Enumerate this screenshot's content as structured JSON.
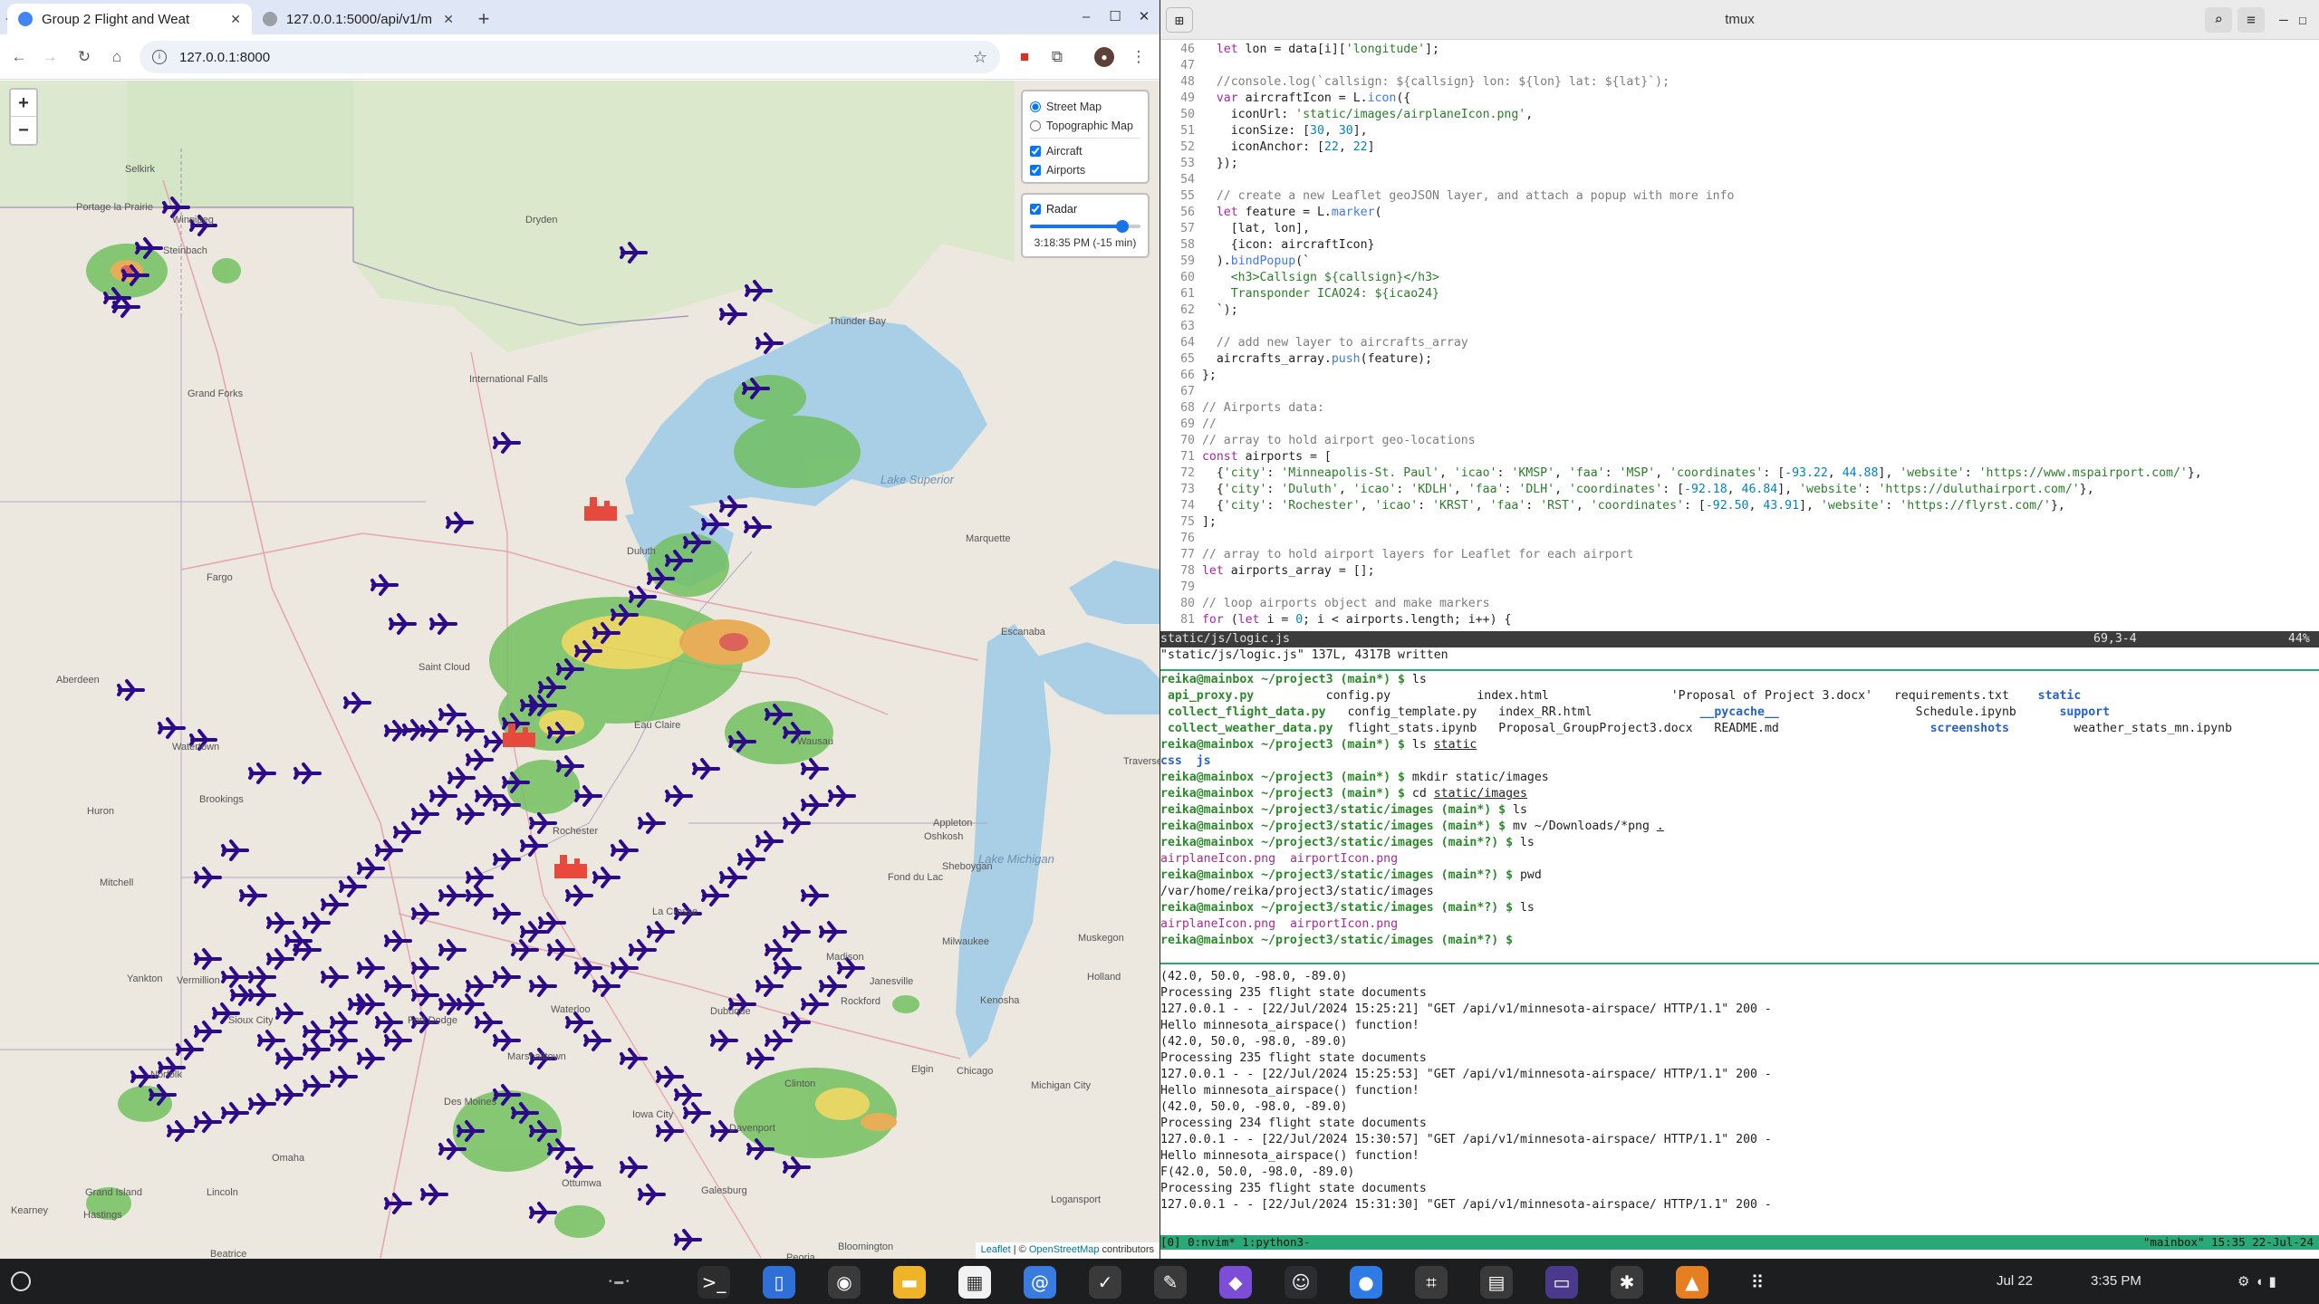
{
  "browser": {
    "tabs": [
      {
        "title": "Group 2 Flight and Weat"
      },
      {
        "title": "127.0.0.1:5000/api/v1/m"
      }
    ],
    "url": "127.0.0.1:8000"
  },
  "map": {
    "base_layers": [
      "Street Map",
      "Topographic Map"
    ],
    "selected_base": "Street Map",
    "overlays": [
      {
        "label": "Aircraft",
        "checked": true
      },
      {
        "label": "Airports",
        "checked": true
      }
    ],
    "radar": {
      "label": "Radar",
      "checked": true,
      "time": "3:18:35 PM (-15 min)",
      "slider_fraction": 0.82
    },
    "zoom_in": "+",
    "zoom_out": "−",
    "attribution": {
      "leaflet": "Leaflet",
      "sep": " | © ",
      "osm": "OpenStreetMap",
      "tail": " contributors"
    },
    "places": [
      {
        "name": "Selkirk",
        "cls": ""
      },
      {
        "name": "Portage la Prairie",
        "cls": ""
      },
      {
        "name": "Winnipeg",
        "cls": ""
      },
      {
        "name": "Steinbach",
        "cls": ""
      },
      {
        "name": "Dryden",
        "cls": ""
      },
      {
        "name": "Thunder Bay",
        "cls": ""
      },
      {
        "name": "International Falls",
        "cls": ""
      },
      {
        "name": "Grand Forks",
        "cls": ""
      },
      {
        "name": "Lake Superior",
        "cls": "lake"
      },
      {
        "name": "Fargo",
        "cls": ""
      },
      {
        "name": "Duluth",
        "cls": ""
      },
      {
        "name": "Marquette",
        "cls": ""
      },
      {
        "name": "Aberdeen",
        "cls": ""
      },
      {
        "name": "Saint Cloud",
        "cls": ""
      },
      {
        "name": "Escanaba",
        "cls": ""
      },
      {
        "name": "Watertown",
        "cls": ""
      },
      {
        "name": "Brookings",
        "cls": ""
      },
      {
        "name": "Eau Claire",
        "cls": ""
      },
      {
        "name": "Wausau",
        "cls": ""
      },
      {
        "name": "Traverse City",
        "cls": ""
      },
      {
        "name": "Huron",
        "cls": ""
      },
      {
        "name": "Rochester",
        "cls": ""
      },
      {
        "name": "Appleton",
        "cls": ""
      },
      {
        "name": "Oshkosh",
        "cls": ""
      },
      {
        "name": "Lake Michigan",
        "cls": "lake"
      },
      {
        "name": "Mitchell",
        "cls": ""
      },
      {
        "name": "La Crosse",
        "cls": ""
      },
      {
        "name": "Sheboygan",
        "cls": ""
      },
      {
        "name": "Fond du Lac",
        "cls": ""
      },
      {
        "name": "Milwaukee",
        "cls": ""
      },
      {
        "name": "Muskegon",
        "cls": ""
      },
      {
        "name": "Madison",
        "cls": ""
      },
      {
        "name": "Janesville",
        "cls": ""
      },
      {
        "name": "Holland",
        "cls": ""
      },
      {
        "name": "Yankton",
        "cls": ""
      },
      {
        "name": "Vermillion",
        "cls": ""
      },
      {
        "name": "Sioux City",
        "cls": ""
      },
      {
        "name": "Fort Dodge",
        "cls": ""
      },
      {
        "name": "Waterloo",
        "cls": ""
      },
      {
        "name": "Dubuque",
        "cls": ""
      },
      {
        "name": "Rockford",
        "cls": ""
      },
      {
        "name": "Kenosha",
        "cls": ""
      },
      {
        "name": "Norfolk",
        "cls": ""
      },
      {
        "name": "Marshalltown",
        "cls": ""
      },
      {
        "name": "Elgin",
        "cls": ""
      },
      {
        "name": "Chicago",
        "cls": ""
      },
      {
        "name": "Michigan City",
        "cls": ""
      },
      {
        "name": "Des Moines",
        "cls": ""
      },
      {
        "name": "Iowa City",
        "cls": ""
      },
      {
        "name": "Davenport",
        "cls": ""
      },
      {
        "name": "Clinton",
        "cls": ""
      },
      {
        "name": "Omaha",
        "cls": ""
      },
      {
        "name": "Ottumwa",
        "cls": ""
      },
      {
        "name": "Galesburg",
        "cls": ""
      },
      {
        "name": "Logansport",
        "cls": ""
      },
      {
        "name": "Lincoln",
        "cls": ""
      },
      {
        "name": "Grand Island",
        "cls": ""
      },
      {
        "name": "Hastings",
        "cls": ""
      },
      {
        "name": "Kearney",
        "cls": ""
      },
      {
        "name": "Beatrice",
        "cls": ""
      },
      {
        "name": "Peoria",
        "cls": ""
      },
      {
        "name": "Bloomington",
        "cls": ""
      }
    ]
  },
  "terminal": {
    "title": "tmux",
    "code_lines": [
      {
        "n": "46",
        "html": "  <span class=\"kw\">let</span> lon = data[i][<span class=\"st\">'longitude'</span>];"
      },
      {
        "n": "47",
        "html": ""
      },
      {
        "n": "48",
        "html": "  <span class=\"cm\">//console.log(`callsign: ${callsign} lon: ${lon} lat: ${lat}`);</span>"
      },
      {
        "n": "49",
        "html": "  <span class=\"kw\">var</span> aircraftIcon = L.<span class=\"fn\">icon</span>({"
      },
      {
        "n": "50",
        "html": "    iconUrl: <span class=\"st\">'static/images/airplaneIcon.png'</span>,"
      },
      {
        "n": "51",
        "html": "    iconSize: [<span class=\"nm\">30</span>, <span class=\"nm\">30</span>],"
      },
      {
        "n": "52",
        "html": "    iconAnchor: [<span class=\"nm\">22</span>, <span class=\"nm\">22</span>]"
      },
      {
        "n": "53",
        "html": "  });"
      },
      {
        "n": "54",
        "html": ""
      },
      {
        "n": "55",
        "html": "  <span class=\"cm\">// create a new Leaflet geoJSON layer, and attach a popup with more info</span>"
      },
      {
        "n": "56",
        "html": "  <span class=\"kw\">let</span> feature = L.<span class=\"fn\">marker</span>("
      },
      {
        "n": "57",
        "html": "    [lat, lon],"
      },
      {
        "n": "58",
        "html": "    {icon: aircraftIcon}"
      },
      {
        "n": "59",
        "html": "  ).<span class=\"fn\">bindPopup</span>(`"
      },
      {
        "n": "60",
        "html": "    <span class=\"st\">&lt;h3&gt;Callsign ${callsign}&lt;/h3&gt;</span>"
      },
      {
        "n": "61",
        "html": "    <span class=\"st\">Transponder ICAO24: ${icao24}</span>"
      },
      {
        "n": "62",
        "html": "  `);"
      },
      {
        "n": "63",
        "html": ""
      },
      {
        "n": "64",
        "html": "  <span class=\"cm\">// add new layer to aircrafts_array</span>"
      },
      {
        "n": "65",
        "html": "  aircrafts_array.<span class=\"fn\">push</span>(feature);"
      },
      {
        "n": "66",
        "html": "};"
      },
      {
        "n": "67",
        "html": ""
      },
      {
        "n": "68",
        "html": "<span class=\"cm\">// Airports data:</span>"
      },
      {
        "n": "69",
        "html": "<span class=\"cm\">//</span>"
      },
      {
        "n": "70",
        "html": "<span class=\"cm\">// array to hold airport geo-locations</span>"
      },
      {
        "n": "71",
        "html": "<span class=\"kw\">const</span> airports = ["
      },
      {
        "n": "72",
        "html": "  {<span class=\"st\">'city'</span>: <span class=\"st\">'Minneapolis-St. Paul'</span>, <span class=\"st\">'icao'</span>: <span class=\"st\">'KMSP'</span>, <span class=\"st\">'faa'</span>: <span class=\"st\">'MSP'</span>, <span class=\"st\">'coordinates'</span>: [<span class=\"nm\">-93.22</span>, <span class=\"nm\">44.88</span>], <span class=\"st\">'website'</span>: <span class=\"st\">'https://www.mspairport.com/'</span>},"
      },
      {
        "n": "73",
        "html": "  {<span class=\"st\">'city'</span>: <span class=\"st\">'Duluth'</span>, <span class=\"st\">'icao'</span>: <span class=\"st\">'KDLH'</span>, <span class=\"st\">'faa'</span>: <span class=\"st\">'DLH'</span>, <span class=\"st\">'coordinates'</span>: [<span class=\"nm\">-92.18</span>, <span class=\"nm\">46.84</span>], <span class=\"st\">'website'</span>: <span class=\"st\">'https://duluthairport.com/'</span>},"
      },
      {
        "n": "74",
        "html": "  {<span class=\"st\">'city'</span>: <span class=\"st\">'Rochester'</span>, <span class=\"st\">'icao'</span>: <span class=\"st\">'KRST'</span>, <span class=\"st\">'faa'</span>: <span class=\"st\">'RST'</span>, <span class=\"st\">'coordinates'</span>: [<span class=\"nm\">-92.50</span>, <span class=\"nm\">43.91</span>], <span class=\"st\">'website'</span>: <span class=\"st\">'https://flyrst.com/'</span>},"
      },
      {
        "n": "75",
        "html": "];"
      },
      {
        "n": "76",
        "html": ""
      },
      {
        "n": "77",
        "html": "<span class=\"cm\">// array to hold airport layers for Leaflet for each airport</span>"
      },
      {
        "n": "78",
        "html": "<span class=\"kw\">let</span> airports_array = [];"
      },
      {
        "n": "79",
        "html": ""
      },
      {
        "n": "80",
        "html": "<span class=\"cm\">// loop airports object and make markers</span>"
      },
      {
        "n": "81",
        "html": "<span class=\"kw\">for</span> (<span class=\"kw\">let</span> i = <span class=\"nm\">0</span>; i &lt; airports.length; i++) {"
      }
    ],
    "status_file": "static/js/logic.js",
    "status_pos": "69,3-4",
    "status_pct": "44%",
    "written_msg": "\"static/js/logic.js\" 137L, 4317B written",
    "shell_lines": [
      {
        "html": "<span class=\"pr\">reika@mainbox ~/project3 (main*) $</span> ls"
      },
      {
        "html": " <span class=\"pr\">api_proxy.py</span>          config.py            index.html                 'Proposal of Project 3.docx'   requirements.txt    <span class=\"dirc\">static</span>"
      },
      {
        "html": " <span class=\"pr\">collect_flight_data.py</span>   config_template.py   index_RR.html               <span class=\"dirc\">__pycache__</span>                   Schedule.ipynb      <span class=\"dirc\">support</span>"
      },
      {
        "html": " <span class=\"pr\">collect_weather_data.py</span>  flight_stats.ipynb   Proposal_GroupProject3.docx   README.md                     <span class=\"dirc\">screenshots</span>         weather_stats_mn.ipynb"
      },
      {
        "html": "<span class=\"pr\">reika@mainbox ~/project3 (main*) $</span> ls <u>static</u>"
      },
      {
        "html": "<span class=\"dirc\">css</span>  <span class=\"dirc\">js</span>"
      },
      {
        "html": "<span class=\"pr\">reika@mainbox ~/project3 (main*) $</span> mkdir static/images"
      },
      {
        "html": "<span class=\"pr\">reika@mainbox ~/project3 (main*) $</span> cd <u>static/images</u>"
      },
      {
        "html": "<span class=\"pr\">reika@mainbox ~/project3/static/images (main*) $</span> ls"
      },
      {
        "html": "<span class=\"pr\">reika@mainbox ~/project3/static/images (main*) $</span> mv ~/Downloads/*png <u>.</u>"
      },
      {
        "html": "<span class=\"pr\">reika@mainbox ~/project3/static/images (main*?) $</span> ls"
      },
      {
        "html": "<span class=\"pngc\">airplaneIcon.png</span>  <span class=\"pngc\">airportIcon.png</span>"
      },
      {
        "html": "<span class=\"pr\">reika@mainbox ~/project3/static/images (main*?) $</span> pwd"
      },
      {
        "html": "/var/home/reika/project3/static/images"
      },
      {
        "html": "<span class=\"pr\">reika@mainbox ~/project3/static/images (main*?) $</span> ls"
      },
      {
        "html": "<span class=\"pngc\">airplaneIcon.png</span>  <span class=\"pngc\">airportIcon.png</span>"
      },
      {
        "html": "<span class=\"pr\">reika@mainbox ~/project3/static/images (main*?) $</span> "
      }
    ],
    "log_lines": [
      "(42.0, 50.0, -98.0, -89.0)",
      "Processing 235 flight state documents",
      "127.0.0.1 - - [22/Jul/2024 15:25:21] \"GET /api/v1/minnesota-airspace/ HTTP/1.1\" 200 -",
      "Hello minnesota_airspace() function!",
      "(42.0, 50.0, -98.0, -89.0)",
      "Processing 235 flight state documents",
      "127.0.0.1 - - [22/Jul/2024 15:25:53] \"GET /api/v1/minnesota-airspace/ HTTP/1.1\" 200 -",
      "Hello minnesota_airspace() function!",
      "(42.0, 50.0, -98.0, -89.0)",
      "Processing 234 flight state documents",
      "127.0.0.1 - - [22/Jul/2024 15:30:57] \"GET /api/v1/minnesota-airspace/ HTTP/1.1\" 200 -",
      "Hello minnesota_airspace() function!",
      "F(42.0, 50.0, -98.0, -89.0)",
      "Processing 235 flight state documents",
      "127.0.0.1 - - [22/Jul/2024 15:31:30] \"GET /api/v1/minnesota-airspace/ HTTP/1.1\" 200 -"
    ],
    "tmux_bar_left": "[0] 0:nvim* 1:python3-",
    "tmux_bar_right": "\"mainbox\" 15:35 22-Jul-24"
  },
  "shelf": {
    "date": "Jul 22",
    "time": "3:35 PM",
    "apps": [
      {
        "name": "terminal-app-icon",
        "glyph": ">_",
        "bg": "#2d2d2d"
      },
      {
        "name": "files-app-icon",
        "glyph": "▯",
        "bg": "#2f6fd6"
      },
      {
        "name": "chrome-app-icon",
        "glyph": "◉",
        "bg": "#3a3a3a"
      },
      {
        "name": "notes-app-icon",
        "glyph": "▬",
        "bg": "#f0b429"
      },
      {
        "name": "calendar-app-icon",
        "glyph": "▦",
        "bg": "#f2f2f2"
      },
      {
        "name": "email-app-icon",
        "glyph": "@",
        "bg": "#3a7be0"
      },
      {
        "name": "tasks-app-icon",
        "glyph": "✓",
        "bg": "#3a3a3a"
      },
      {
        "name": "editor-app-icon",
        "glyph": "✎",
        "bg": "#3a3a3a"
      },
      {
        "name": "obsidian-app-icon",
        "glyph": "◆",
        "bg": "#7c4dd6"
      },
      {
        "name": "discord-app-icon",
        "glyph": "☺",
        "bg": "#2b2d31"
      },
      {
        "name": "chat-app-icon",
        "glyph": "●",
        "bg": "#2f7be6"
      },
      {
        "name": "screenshot-app-icon",
        "glyph": "⌗",
        "bg": "#3a3a3a"
      },
      {
        "name": "store-app-icon",
        "glyph": "▤",
        "bg": "#3a3a3a"
      },
      {
        "name": "media-app-icon",
        "glyph": "▭",
        "bg": "#4b3a8c"
      },
      {
        "name": "slack-app-icon",
        "glyph": "✱",
        "bg": "#3a3a3a"
      },
      {
        "name": "vlc-app-icon",
        "glyph": "▲",
        "bg": "#e67e22"
      },
      {
        "name": "launcher-app-icon",
        "glyph": "⠿",
        "bg": "#1d1e20"
      }
    ]
  }
}
